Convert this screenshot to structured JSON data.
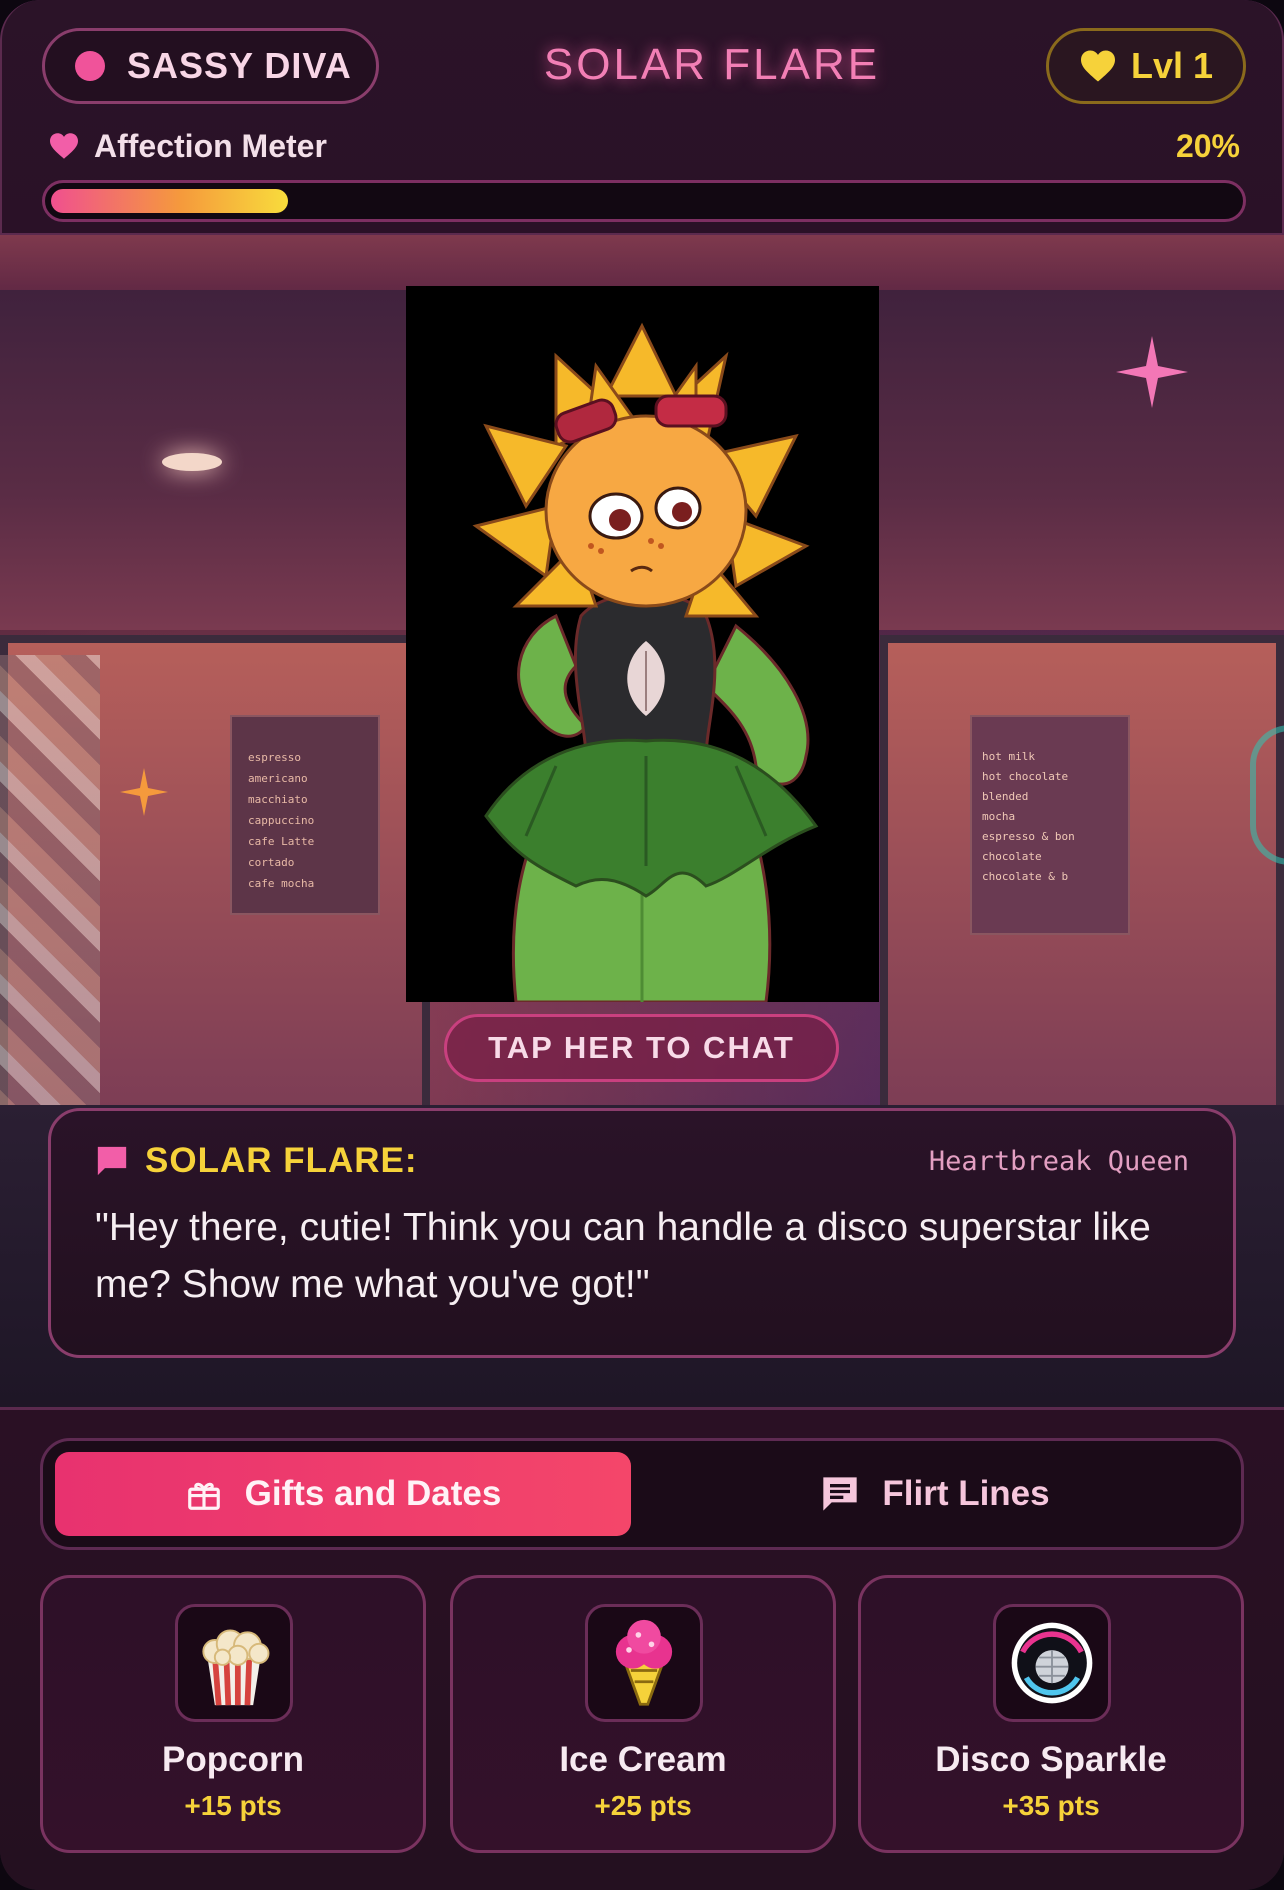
{
  "header": {
    "mood_label": "SASSY DIVA",
    "character_title": "SOLAR FLARE",
    "level_label": "Lvl 1",
    "affection_label": "Affection Meter",
    "affection_value": "20%",
    "affection_fraction": 0.2
  },
  "scene": {
    "menu_left": [
      "espresso",
      "americano",
      "macchiato",
      "cappuccino",
      "cafe Latte",
      "cortado",
      "cafe mocha"
    ],
    "menu_right": [
      "hot milk",
      "hot chocolate",
      "blended",
      "mocha",
      "espresso & bon",
      "chocolate",
      "chocolate & b"
    ],
    "tap_label": "TAP HER TO CHAT"
  },
  "dialog": {
    "speaker": "SOLAR FLARE:",
    "tag": "Heartbreak Queen",
    "text": "\"Hey there, cutie! Think you can handle a disco superstar like me? Show me what you've got!\""
  },
  "tabs": [
    {
      "label": "Gifts and Dates",
      "icon": "gift-icon",
      "active": true
    },
    {
      "label": "Flirt Lines",
      "icon": "chat-icon",
      "active": false
    }
  ],
  "gifts": [
    {
      "name": "Popcorn",
      "points": "+15 pts",
      "icon": "popcorn-icon"
    },
    {
      "name": "Ice Cream",
      "points": "+25 pts",
      "icon": "ice-cream-icon"
    },
    {
      "name": "Disco Sparkle",
      "points": "+35 pts",
      "icon": "disco-ball-icon"
    }
  ],
  "colors": {
    "accent_pink": "#f0539a",
    "accent_gold": "#f6d23a",
    "panel_dark": "#2a1024"
  }
}
